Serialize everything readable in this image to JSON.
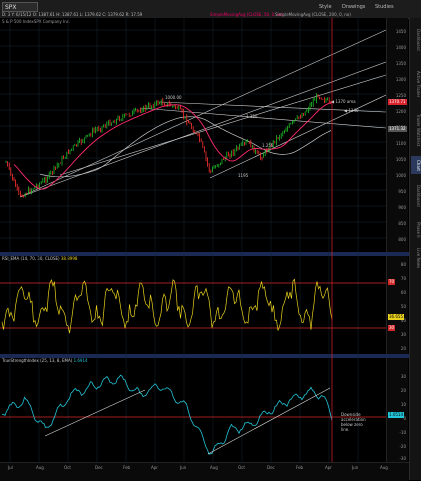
{
  "toolbar": {
    "symbol": "SPX",
    "quote": "D: 3 Y: 6/15/12 O: 1387.61 H: 1387.61 L: 1379.62 C: 1379.62 R: 17.59",
    "tabs": [
      "Style",
      "Drawings",
      "Studies"
    ]
  },
  "price_pane": {
    "title": "S & P 500 IndexSPX Company Inc.",
    "study_labels": [
      "SimpleMovingAvg (CLOSE, 50, 0, no)",
      "SimpleMovingAvg (CLOSE, 200, 0, no)"
    ],
    "y_ticks": [
      "1450",
      "1400",
      "1350",
      "1300",
      "1250",
      "1200",
      "1150",
      "1100",
      "1050",
      "1000",
      "950",
      "900",
      "850",
      "800"
    ],
    "last_price": "1370.71",
    "level_2": "1371.32",
    "annotations": {
      "a1370": "1370 ama",
      "a1340": "1340",
      "l1000": "1000.00",
      "l1330": "1.330",
      "l1255": "1.255",
      "l1195": "1195"
    },
    "colors": {
      "price_up": "#1fc12b",
      "price_down": "#ff3030",
      "ma50": "#ff2a6d",
      "ma200": "#c7c7c7",
      "trendline": "#d0d0d0",
      "cursor": "#d9232d"
    }
  },
  "rsi_pane": {
    "label": "RSI_EMA (14, 70, 30, CLOSE)",
    "value_label": "38.8998",
    "last_value": "36.655",
    "y_ticks": [
      "80",
      "70",
      "60",
      "50",
      "40",
      "30",
      "20"
    ],
    "level_upper": "70",
    "level_lower": "30",
    "colors": {
      "line": "#e9d21d",
      "bands": "#d42a2a"
    }
  },
  "tsi_pane": {
    "label": "TrueStrengthIndex (25, 13, 8, EMA)",
    "value_label": "1.6914",
    "last_value": "1.0514",
    "y_ticks": [
      "30",
      "20",
      "10",
      "0",
      "-10",
      "-20",
      "-30"
    ],
    "note": "Downside acceleration below zero line.",
    "colors": {
      "line": "#23c5d8",
      "trendline": "#dddddd"
    }
  },
  "x_axis": {
    "labels": [
      "Jul",
      "Aug",
      "Oct",
      "Dec",
      "Feb",
      "Apr",
      "Jun",
      "Aug",
      "Oct",
      "Dec",
      "Feb",
      "Apr",
      "Jun",
      "Aug"
    ]
  },
  "sidebar": {
    "tabs": [
      "Dashboard",
      "Active Trader",
      "Trader Watchlist",
      "Chart",
      "Dashboard",
      "Phase II",
      "Live News"
    ]
  }
}
